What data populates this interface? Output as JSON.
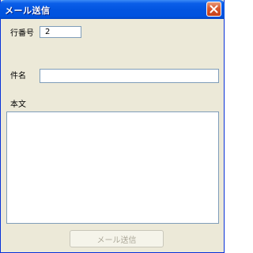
{
  "window": {
    "title": "メール送信"
  },
  "form": {
    "row_number_label": "行番号",
    "row_number_value": "2",
    "subject_label": "件名",
    "subject_value": "",
    "body_label": "本文",
    "body_value": ""
  },
  "actions": {
    "send_label": "メール送信",
    "send_enabled": false
  },
  "icons": {
    "close": "close-icon"
  },
  "colors": {
    "titlebar": "#0254e0",
    "close_button": "#d9572c",
    "dialog_background": "#ece9d8",
    "input_border": "#7f9db9",
    "disabled_text": "#aca899"
  }
}
